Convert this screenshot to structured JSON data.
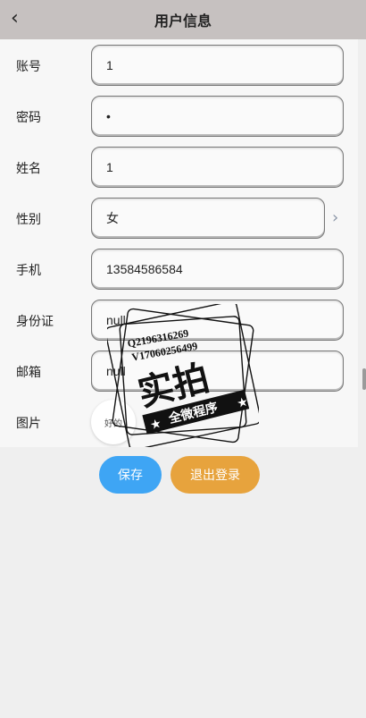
{
  "header": {
    "title": "用户信息",
    "back_icon": "chevron-left-icon"
  },
  "form": {
    "fields": [
      {
        "label": "账号",
        "value": "1"
      },
      {
        "label": "密码",
        "value": "•"
      },
      {
        "label": "姓名",
        "value": "1"
      },
      {
        "label": "性别",
        "value": "女"
      },
      {
        "label": "手机",
        "value": "13584586584"
      },
      {
        "label": "身份证",
        "value": "null"
      },
      {
        "label": "邮箱",
        "value": "null"
      },
      {
        "label": "图片",
        "value": ""
      }
    ],
    "gender_chevron": "chevron-right-icon",
    "avatar_text": "好的"
  },
  "actions": {
    "save": "保存",
    "logout": "退出登录"
  },
  "watermark": {
    "line1": "Q2196316269",
    "line2": "V17060256499",
    "main": "实拍",
    "banner": "全微程序"
  },
  "colors": {
    "header_bg": "#c6c1c0",
    "save_button": "#3ea5f4",
    "logout_button": "#e7a33d"
  }
}
